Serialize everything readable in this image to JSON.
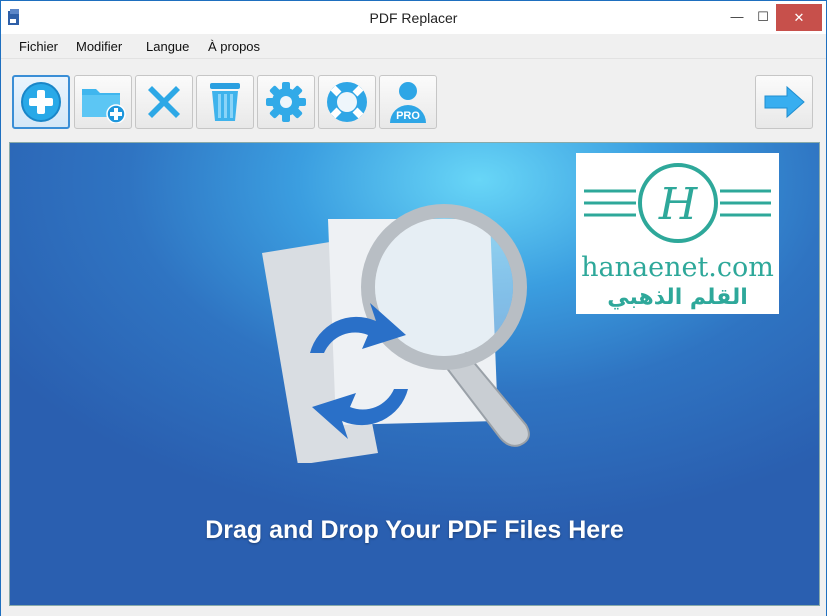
{
  "window": {
    "title": "PDF Replacer",
    "controls": {
      "minimize": "—",
      "maximize": "☐",
      "close": "✕"
    }
  },
  "menu": {
    "items": [
      "Fichier",
      "Modifier",
      "Langue",
      "À propos"
    ]
  },
  "toolbar": {
    "buttons": [
      {
        "icon": "add-file-icon"
      },
      {
        "icon": "add-folder-icon"
      },
      {
        "icon": "remove-icon"
      },
      {
        "icon": "trash-icon"
      },
      {
        "icon": "settings-gear-icon"
      },
      {
        "icon": "help-lifebuoy-icon"
      },
      {
        "icon": "pro-user-icon",
        "badge": "PRO"
      },
      {
        "icon": "next-arrow-icon"
      }
    ]
  },
  "droparea": {
    "instruction": "Drag and Drop Your PDF Files Here"
  },
  "watermark": {
    "monogram": "H",
    "url": "hanaenet.com",
    "arabic": "القلم الذهبي"
  },
  "colors": {
    "accent_blue": "#2f74c2",
    "icon_blue": "#29a9e8",
    "watermark_teal": "#2ea89a",
    "close_red": "#c7504b"
  }
}
